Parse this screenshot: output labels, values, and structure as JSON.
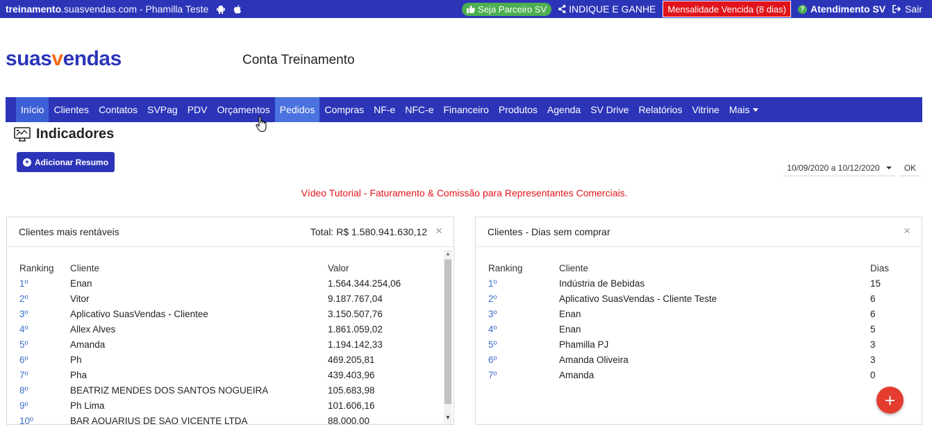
{
  "topbar": {
    "site_bold": "treinamento",
    "site_rest": ".suasvendas.com - Phamilla Teste",
    "parceiro_label": "Seja Parceiro SV",
    "indique_label": "INDIQUE E GANHE",
    "mensalidade_label": "Mensalidade Vencida (8 dias)",
    "atendimento_label": "Atendimento SV",
    "sair_label": "Sair"
  },
  "header": {
    "logo_part1": "suas",
    "logo_v": "v",
    "logo_part2": "endas",
    "account_name": "Conta Treinamento"
  },
  "nav": {
    "items": [
      "Início",
      "Clientes",
      "Contatos",
      "SVPag",
      "PDV",
      "Orçamentos",
      "Pedidos",
      "Compras",
      "NF-e",
      "NFC-e",
      "Financeiro",
      "Produtos",
      "Agenda",
      "SV Drive",
      "Relatórios",
      "Vitrine",
      "Mais"
    ]
  },
  "page": {
    "title": "Indicadores",
    "add_button": "Adicionar Resumo",
    "date_range": "10/09/2020 a 10/12/2020",
    "ok_button": "OK",
    "tutorial_link": "Vídeo Tutorial - Faturamento & Comissão para Representantes Comerciais."
  },
  "panel_rentaveis": {
    "title": "Clientes mais rentáveis",
    "total": "Total: R$ 1.580.941.630,12",
    "headers": [
      "Ranking",
      "Cliente",
      "Valor"
    ],
    "rows": [
      [
        "1º",
        "Enan",
        "1.564.344.254,06"
      ],
      [
        "2º",
        "Vitor",
        "9.187.767,04"
      ],
      [
        "3º",
        "Aplicativo SuasVendas - Clientee",
        "3.150.507,76"
      ],
      [
        "4º",
        "Allex Alves",
        "1.861.059,02"
      ],
      [
        "5º",
        "Amanda",
        "1.194.142,33"
      ],
      [
        "6º",
        "Ph",
        "469.205,81"
      ],
      [
        "7º",
        "Pha",
        "439.403,96"
      ],
      [
        "8º",
        "BEATRIZ MENDES DOS SANTOS NOGUEIRA",
        "105.683,98"
      ],
      [
        "9º",
        "Ph Lima",
        "101.606,16"
      ],
      [
        "10º",
        "BAR AQUARIUS DE SAO VICENTE LTDA",
        "88.000,00"
      ]
    ]
  },
  "panel_dias": {
    "title": "Clientes - Dias sem comprar",
    "headers": [
      "Ranking",
      "Cliente",
      "Dias"
    ],
    "rows": [
      [
        "1º",
        "Indústria de Bebidas",
        "15"
      ],
      [
        "2º",
        "Aplicativo SuasVendas - Cliente Teste",
        "6"
      ],
      [
        "3º",
        "Enan",
        "6"
      ],
      [
        "4º",
        "Enan",
        "5"
      ],
      [
        "5º",
        "Phamilla PJ",
        "3"
      ],
      [
        "6º",
        "Amanda Oliveira",
        "3"
      ],
      [
        "7º",
        "Amanda",
        "0"
      ]
    ]
  },
  "fab_label": "+",
  "close_glyph": "×"
}
